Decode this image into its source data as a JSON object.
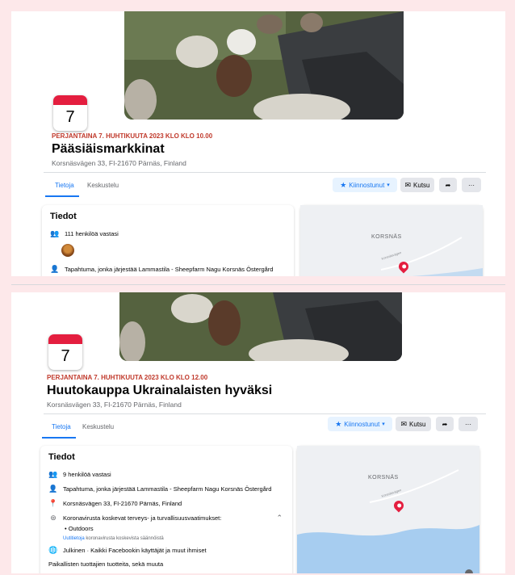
{
  "events": [
    {
      "calendar_day": "7",
      "date_line": "PERJANTAINA 7. HUHTIKUUTA 2023 KLO KLO 10.00",
      "title": "Pääsiäismarkkinat",
      "address": "Korsnäsvägen 33, FI-21670 Pärnäs, Finland",
      "tabs": [
        "Tietoja",
        "Keskustelu"
      ],
      "buttons": {
        "interested": "Kiinnostunut",
        "invite": "Kutsu",
        "more": "···"
      },
      "details": {
        "heading": "Tiedot",
        "responded": "111 henkilöä vastasi",
        "organizer": "Tapahtuma, jonka järjestää Lammastila - Sheepfarm Nagu Korsnäs Östergård"
      },
      "map": {
        "place_label": "KORSNÄS",
        "road_label": "Korsnäsvägen"
      }
    },
    {
      "calendar_day": "7",
      "date_line": "PERJANTAINA 7. HUHTIKUUTA 2023 KLO KLO 12.00",
      "title": "Huutokauppa Ukrainalaisten hyväksi",
      "address": "Korsnäsvägen 33, FI-21670 Pärnäs, Finland",
      "tabs": [
        "Tietoja",
        "Keskustelu"
      ],
      "buttons": {
        "interested": "Kiinnostunut",
        "invite": "Kutsu",
        "more": "···"
      },
      "details": {
        "heading": "Tiedot",
        "responded": "9 henkilöä vastasi",
        "organizer": "Tapahtuma, jonka järjestää Lammastila - Sheepfarm Nagu Korsnäs Östergård",
        "location": "Korsnäsvägen 33, FI-21670 Pärnäs, Finland",
        "covid": "Koronavirusta koskevat terveys- ja turvallisuusvaatimukset:",
        "covid_item": "Outdoors",
        "covid_link_prefix": "Uutitietoja",
        "covid_link_rest": "koronavirusta koskevista säännöistä",
        "visibility": "Julkinen · Kaikki Facebookin käyttäjät ja muut ihmiset",
        "description": "Paikallisten tuottajien tuotteita, sekä muuta"
      },
      "map": {
        "place_label": "KORSNÄS",
        "road_label": "Korsnäsvägen"
      }
    }
  ],
  "colors": {
    "accent": "#1877f2",
    "calendar_red": "#e41e3f",
    "date_red": "#c0392b",
    "background": "#fde8ea"
  },
  "icons": [
    "people-icon",
    "avatar",
    "person-icon",
    "location-pin-icon",
    "virus-icon",
    "globe-icon",
    "star-icon",
    "envelope-icon",
    "share-arrow-icon",
    "chevron-up-icon",
    "map-pin-icon"
  ]
}
